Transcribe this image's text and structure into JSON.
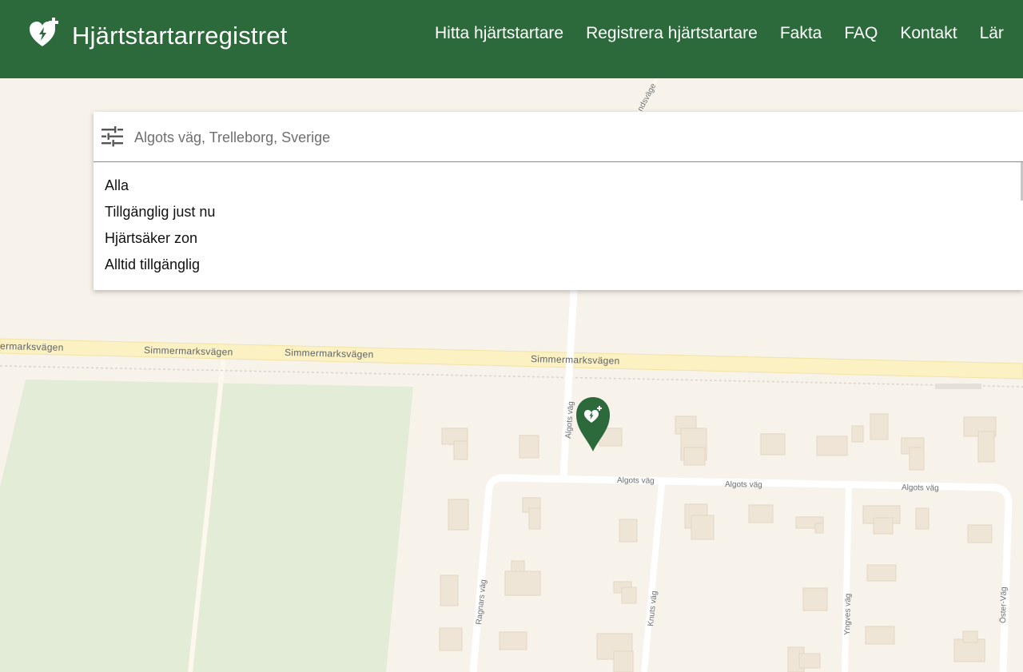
{
  "header": {
    "title": "Hjärtstartarregistret",
    "logo_icon": "heart-defibrillator-icon",
    "background_color": "#2d6a3b",
    "nav": [
      {
        "label": "Hitta hjärtstartare"
      },
      {
        "label": "Registrera hjärtstartare"
      },
      {
        "label": "Fakta"
      },
      {
        "label": "FAQ"
      },
      {
        "label": "Kontakt"
      },
      {
        "label": "Lär"
      }
    ]
  },
  "search": {
    "placeholder": "Algots väg, Trelleborg, Sverige",
    "filter_icon": "sliders-icon",
    "filters": [
      {
        "label": "Alla"
      },
      {
        "label": "Tillgänglig just nu"
      },
      {
        "label": "Hjärtsäker zon"
      },
      {
        "label": "Alltid tillgänglig"
      }
    ]
  },
  "map": {
    "roads": {
      "simmermarksvagen": "Simmermarksvägen",
      "simmermarksvagen_cut": "ermarksvägen",
      "algots_vag": "Algots väg",
      "ragnars_vag": "Ragnars väg",
      "knuts_vag": "Knuts väg",
      "yngves_vag": "Yngves väg",
      "oster_vag": "Öster-Väg",
      "top_road_cut": "ndsväge"
    },
    "marker_icon": "defibrillator-map-marker-icon",
    "colors": {
      "land": "#f7f2ea",
      "park": "#e2ecd6",
      "building": "#efe5d6",
      "major_road": "#fbf1c2",
      "marker": "#2d6a3b"
    }
  }
}
